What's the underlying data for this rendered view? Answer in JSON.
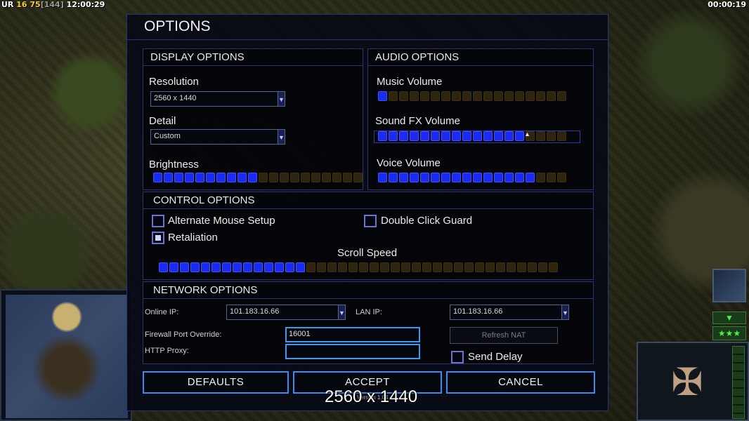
{
  "hud": {
    "left_prefix": "UR",
    "left_num1": "16",
    "left_num2": "75",
    "left_bracket": "[144]",
    "left_time": "12:00:29",
    "right_time": "00:00:19"
  },
  "dialog": {
    "title": "OPTIONS",
    "display": {
      "header": "DISPLAY OPTIONS",
      "resolution_label": "Resolution",
      "resolution_value": "2560 x 1440",
      "detail_label": "Detail",
      "detail_value": "Custom",
      "brightness_label": "Brightness",
      "brightness_level": 10,
      "brightness_segments": 20
    },
    "audio": {
      "header": "AUDIO OPTIONS",
      "music_label": "Music Volume",
      "music_level": 1,
      "music_segments": 18,
      "sfx_label": "Sound FX Volume",
      "sfx_level": 14,
      "sfx_segments": 18,
      "voice_label": "Voice Volume",
      "voice_level": 15,
      "voice_segments": 18
    },
    "control": {
      "header": "CONTROL OPTIONS",
      "alt_mouse_label": "Alternate Mouse Setup",
      "alt_mouse_checked": false,
      "double_click_label": "Double Click Guard",
      "double_click_checked": false,
      "retaliation_label": "Retaliation",
      "retaliation_checked": true,
      "scroll_label": "Scroll Speed",
      "scroll_level": 14,
      "scroll_segments": 38
    },
    "network": {
      "header": "NETWORK OPTIONS",
      "online_ip_label": "Online IP:",
      "online_ip_value": "101.183.16.66",
      "lan_ip_label": "LAN IP:",
      "lan_ip_value": "101.183.16.66",
      "firewall_label": "Firewall Port Override:",
      "firewall_value": "16001",
      "http_proxy_label": "HTTP Proxy:",
      "http_proxy_value": "",
      "refresh_nat_label": "Refresh NAT",
      "send_delay_label": "Send Delay",
      "send_delay_checked": false
    },
    "buttons": {
      "defaults": "DEFAULTS",
      "accept": "ACCEPT",
      "cancel": "CANCEL"
    }
  },
  "overlay": {
    "resolution_text": "2560 x 1440",
    "version_text": "Version 1.04"
  },
  "colors": {
    "slider_on": "#1a2cf0",
    "slider_off": "#2e2410",
    "accent_border": "#3a8af0"
  }
}
